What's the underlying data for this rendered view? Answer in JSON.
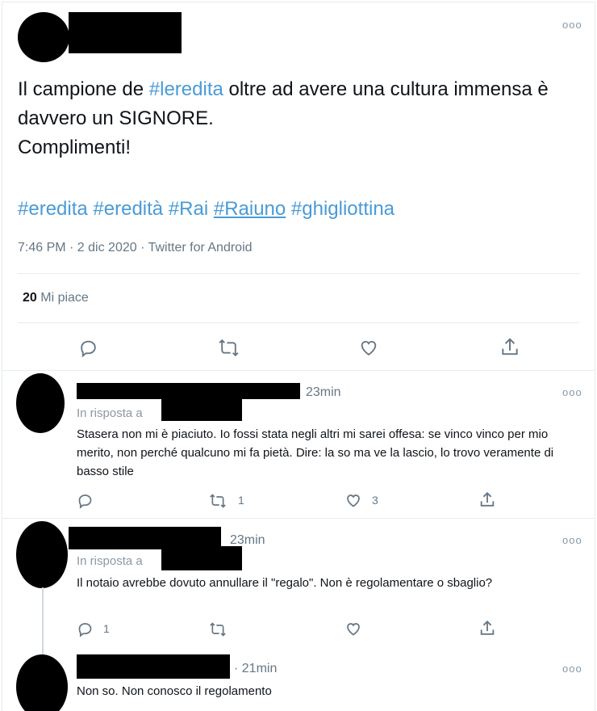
{
  "tweet": {
    "text": [
      "Il campione de ",
      "#leredita",
      " oltre ad avere una cultura immensa è davvero un SIGNORE.",
      "Complimenti!"
    ],
    "hashtags": [
      "#eredita",
      "#eredità",
      "#Rai",
      "#Raiuno",
      "#ghigliottina"
    ],
    "meta": "7:46 PM · 2 dic 2020 · Twitter for Android",
    "likes_count": "20",
    "likes_label": "Mi piace",
    "more": "ooo"
  },
  "replies": [
    {
      "time": "23min",
      "in_reply": "In risposta a",
      "text": "Stasera non mi è piaciuto. Io fossi stata negli altri mi sarei offesa: se vinco vinco per mio merito, non perché qualcuno mi fa pietà. Dire: la so ma ve la lascio, lo trovo veramente di basso stile",
      "retweets": "1",
      "likes": "3",
      "replies": ""
    },
    {
      "time": "23min",
      "in_reply": "In risposta a",
      "text": "Il notaio avrebbe dovuto annullare il \"regalo\". Non è regolamentare o sbaglio?",
      "retweets": "",
      "likes": "",
      "replies": "1"
    },
    {
      "time": "· 21min",
      "in_reply": "",
      "text": "Non so. Non conosco il regolamento",
      "retweets": "",
      "likes": "",
      "replies": ""
    }
  ],
  "icons": {
    "reply": "reply-icon",
    "retweet": "retweet-icon",
    "like": "heart-icon",
    "share": "share-icon",
    "more": "more-icon"
  }
}
